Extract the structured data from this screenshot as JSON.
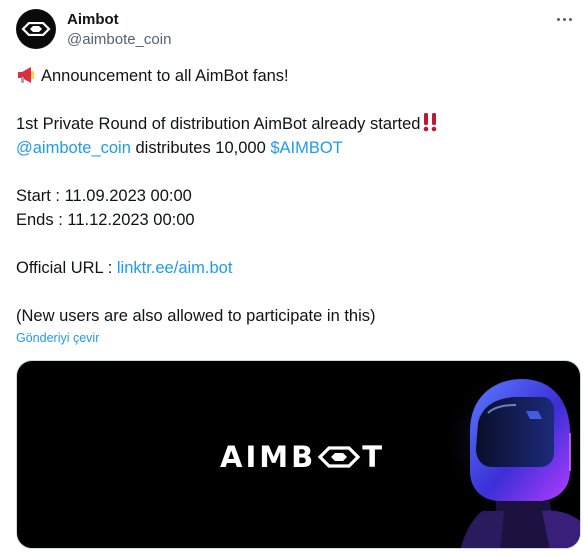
{
  "account": {
    "name": "Aimbot",
    "handle": "@aimbote_coin",
    "avatar_icon": "aimbot-eye-logo-icon"
  },
  "tweet": {
    "line1": "Announcement to all AimBot fans!",
    "line2": "1st Private Round of distribution AimBot already started",
    "line3_mention": "@aimbote_coin",
    "line3_text": " distributes 10,000 ",
    "line3_cashtag": "$AIMBOT",
    "start": "Start : 11.09.2023 00:00",
    "ends": "Ends : 11.12.2023 00:00",
    "url_label": "Official URL : ",
    "url": "linktr.ee/aim.bot",
    "note": "(New users are also allowed to participate in this)",
    "emoji_megaphone": "megaphone-icon",
    "emoji_bang": "double-exclamation-icon"
  },
  "translate_label": "Gönderiyi çevir",
  "media": {
    "logo_left": "AIMB",
    "logo_right": "T",
    "illustration": "robot-helmet-illustration",
    "colors": {
      "background": "#000000",
      "helmet_blue": "#3b5bff",
      "helmet_purple": "#b23cff"
    }
  },
  "more_icon": "more-dots-icon",
  "colors": {
    "link": "#1d9bf0",
    "text": "#0f1419",
    "muted": "#536471"
  }
}
